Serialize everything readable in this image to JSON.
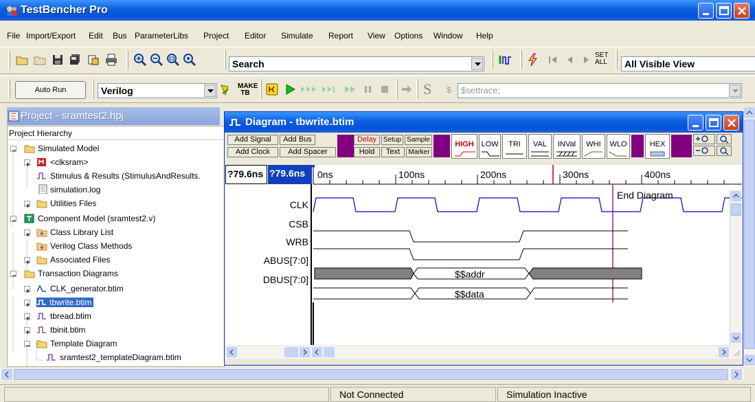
{
  "app": {
    "title": "TestBencher Pro"
  },
  "menu": [
    "File",
    "Import/Export",
    "Edit",
    "Bus",
    "ParameterLibs",
    "Project",
    "Editor",
    "Simulate",
    "Report",
    "View",
    "Options",
    "Window",
    "Help"
  ],
  "toolbar1": {
    "search_value": "Search",
    "set_all_label": "SET ALL",
    "view_value": "All Visible View"
  },
  "toolbar2": {
    "autorun_label": "Auto Run",
    "language_value": "Verilog",
    "make_tb_label": "MAKE TB",
    "script_prefix": "S",
    "dollar_glyph": "$",
    "settrace_value": "$settrace;"
  },
  "project": {
    "title": "Project - sramtest2.hpj",
    "header": "Project Hierarchy",
    "items": [
      "Simulated Model",
      "<clksram>",
      "Stimulus & Results (StimulusAndResults.",
      "simulation.log",
      "Utilities Files",
      "Component Model (sramtest2.v)",
      "Class Library List",
      "Verilog Class Methods",
      "Associated Files",
      "Transaction Diagrams",
      "CLK_generator.btim",
      "tbwrite.btim",
      "tbread.btim",
      "tbinit.btim",
      "Template Diagram",
      "sramtest2_templateDiagram.btim"
    ]
  },
  "diagram": {
    "title": "Diagram - tbwrite.btim",
    "add_signal": "Add Signal",
    "add_bus": "Add Bus",
    "add_clock": "Add Clock",
    "add_spacer": "Add Spacer",
    "delay": "Delay",
    "setup": "Setup",
    "sample": "Sample",
    "hold": "Hold",
    "text": "Text",
    "marker": "Marker",
    "states": [
      "HIGH",
      "LOW",
      "TRI",
      "VAL",
      "INVal",
      "WHI",
      "WLO",
      "HEX"
    ],
    "zoom_in": "Q+",
    "zoom_out": "Q-",
    "time1": "?79.6ns",
    "time2": "?79.6ns",
    "ticks": [
      "0ns",
      "100ns",
      "200ns",
      "300ns",
      "400ns"
    ],
    "end_label": "End Diagram",
    "signals": [
      "CLK",
      "CSB",
      "WRB",
      "ABUS[7:0]",
      "DBUS[7:0]"
    ],
    "abus_value": "$$addr",
    "dbus_value": "$$data"
  },
  "status": {
    "connection": "Not Connected",
    "simulation": "Simulation Inactive"
  },
  "colors": {
    "accent": "#0a5fe0",
    "purple": "#800080",
    "wave": "#0000cc",
    "marker": "#c00000"
  }
}
